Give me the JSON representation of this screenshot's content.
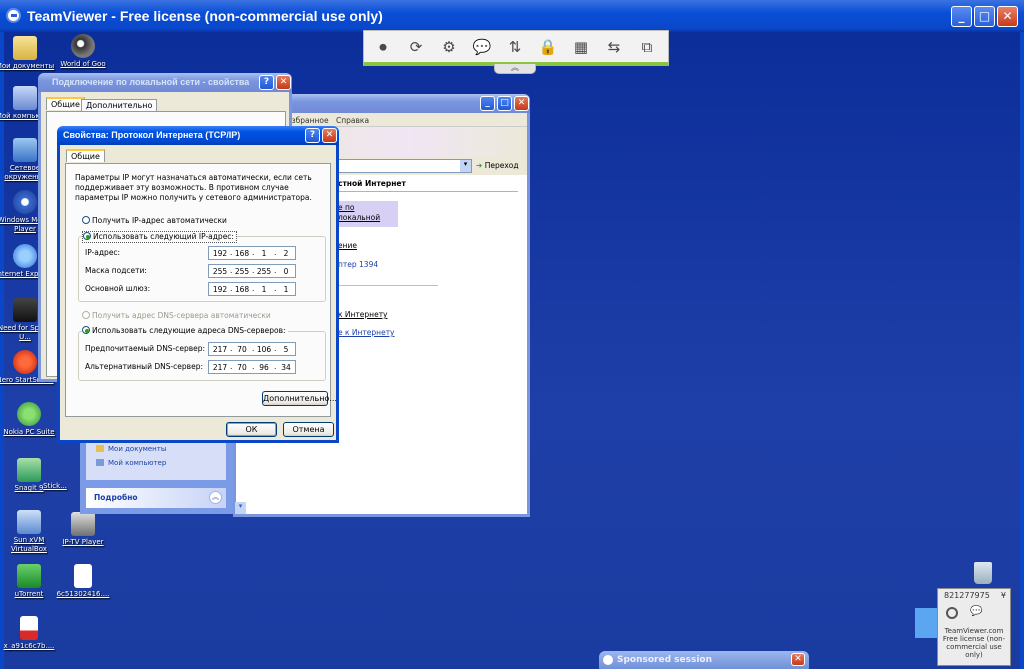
{
  "teamviewer": {
    "title": "TeamViewer - Free license (non-commercial use only)",
    "controls": {
      "minimize": "_",
      "maximize": "□",
      "close": "✕"
    },
    "toolbar_hide": "︽",
    "widget": {
      "id": "821277975",
      "menu": "¥",
      "info": "TeamViewer.com Free license (non-commercial use only)"
    },
    "sponsored": "Sponsored session",
    "colors": {
      "accent": "#8bc53f",
      "title": "#0a4fd8"
    }
  },
  "toolbar": {
    "icons": [
      "close-connection-icon",
      "refresh-icon",
      "settings-icon",
      "chat-icon",
      "file-transfer-icon",
      "lock-icon",
      "layout-icon",
      "switch-sides-icon",
      "remote-windows-icon"
    ],
    "glyphs": [
      "⏺",
      "⟳",
      "⚙",
      "💬",
      "⇅",
      "🔒",
      "▦",
      "⇆",
      "⧉"
    ]
  },
  "desktop_icons": [
    {
      "label": "Мои документы",
      "icon": "my-documents-icon"
    },
    {
      "label": "World of Goo",
      "icon": "world-of-goo-icon"
    },
    {
      "label": "Мой компьютер",
      "icon": "my-computer-icon"
    },
    {
      "label": "Сетевое окружение",
      "icon": "network-places-icon"
    },
    {
      "label": "Windows Media Player",
      "icon": "media-player-icon"
    },
    {
      "label": "Internet Explorer",
      "icon": "internet-explorer-icon"
    },
    {
      "label": "Need for Speed U...",
      "icon": "need-for-speed-icon"
    },
    {
      "label": "Nero StartSmart",
      "icon": "nero-icon"
    },
    {
      "label": "Nokia PC Suite",
      "icon": "nokia-pc-suite-icon"
    },
    {
      "label": "Snagit 9",
      "icon": "snagit-icon"
    },
    {
      "label": "Stick...",
      "icon": "sticky-icon"
    },
    {
      "label": "Sun xVM VirtualBox",
      "icon": "virtualbox-icon"
    },
    {
      "label": "IP-TV Player",
      "icon": "iptv-player-icon"
    },
    {
      "label": "uTorrent",
      "icon": "utorrent-icon"
    },
    {
      "label": "6c51302416....",
      "icon": "mp3-file-icon"
    },
    {
      "label": "x_a91c6c7b....",
      "icon": "pdf-file-icon"
    }
  ],
  "conn_window": {
    "title": "Подключение по локальной сети - свойства",
    "tabs": [
      "Общие",
      "Дополнительно"
    ]
  },
  "network_window": {
    "menu": [
      "Избранное",
      "Справка"
    ],
    "go_label": "Переход",
    "header": "стной Интернет",
    "links": [
      "е по локальной",
      "ение",
      "птер 1394",
      "к Интернету",
      "е к Интернету"
    ],
    "side_links": [
      "Мои документы",
      "Мой компьютер"
    ],
    "details_label": "Подробно"
  },
  "tcpip": {
    "title": "Свойства: Протокол Интернета (TCP/IP)",
    "tab": "Общие",
    "description": "Параметры IP могут назначаться автоматически, если сеть поддерживает эту возможность. В противном случае параметры IP можно получить у сетевого администратора.",
    "auto_ip": "Получить IP-адрес автоматически",
    "manual_ip": "Использовать следующий IP-адрес:",
    "ip_label": "IP-адрес:",
    "mask_label": "Маска подсети:",
    "gateway_label": "Основной шлюз:",
    "ip": [
      "192",
      "168",
      "1",
      "2"
    ],
    "mask": [
      "255",
      "255",
      "255",
      "0"
    ],
    "gateway": [
      "192",
      "168",
      "1",
      "1"
    ],
    "auto_dns": "Получить адрес DNS-сервера автоматически",
    "manual_dns": "Использовать следующие адреса DNS-серверов:",
    "pref_dns_label": "Предпочитаемый DNS-сервер:",
    "alt_dns_label": "Альтернативный DNS-сервер:",
    "pref_dns": [
      "217",
      "70",
      "106",
      "5"
    ],
    "alt_dns": [
      "217",
      "70",
      "96",
      "34"
    ],
    "advanced": "Дополнительно...",
    "ok": "ОК",
    "cancel": "Отмена",
    "help": "?",
    "close": "✕"
  }
}
